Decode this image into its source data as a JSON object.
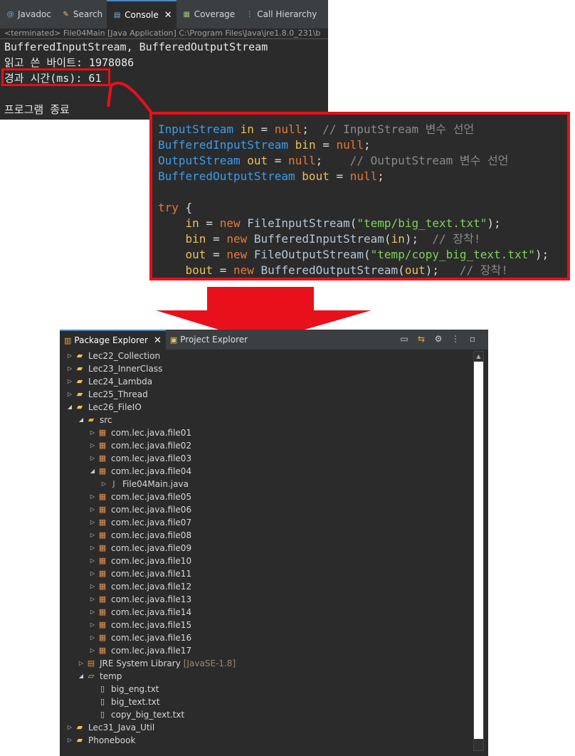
{
  "console": {
    "tabs": [
      {
        "label": "Javadoc",
        "icon": "at-icon",
        "active": false
      },
      {
        "label": "Search",
        "icon": "search-icon",
        "active": false
      },
      {
        "label": "Console",
        "icon": "console-icon",
        "active": true
      },
      {
        "label": "Coverage",
        "icon": "coverage-icon",
        "active": false
      },
      {
        "label": "Call Hierarchy",
        "icon": "hierarchy-icon",
        "active": false
      }
    ],
    "terminated_line": "<terminated> File04Main [Java Application] C:\\Program Files\\Java\\jre1.8.0_231\\b",
    "output": [
      "BufferedInputStream, BufferedOutputStream",
      "읽고 쓴 바이트: 1978086",
      "경과 시간(ms): 61",
      "",
      "프로그램 종료"
    ]
  },
  "code": {
    "lines": [
      [
        [
          "t-type",
          "InputStream"
        ],
        [
          "t-op",
          " "
        ],
        [
          "t-var",
          "in"
        ],
        [
          "t-op",
          " = "
        ],
        [
          "t-kw",
          "null"
        ],
        [
          "t-op",
          ";  "
        ],
        [
          "t-com",
          "// InputStream 변수 선언"
        ]
      ],
      [
        [
          "t-type",
          "BufferedInputStream"
        ],
        [
          "t-op",
          " "
        ],
        [
          "t-var",
          "bin"
        ],
        [
          "t-op",
          " = "
        ],
        [
          "t-kw",
          "null"
        ],
        [
          "t-op",
          ";"
        ]
      ],
      [
        [
          "t-type",
          "OutputStream"
        ],
        [
          "t-op",
          " "
        ],
        [
          "t-var",
          "out"
        ],
        [
          "t-op",
          " = "
        ],
        [
          "t-kw",
          "null"
        ],
        [
          "t-op",
          ";    "
        ],
        [
          "t-com",
          "// OutputStream 변수 선언"
        ]
      ],
      [
        [
          "t-type",
          "BufferedOutputStream"
        ],
        [
          "t-op",
          " "
        ],
        [
          "t-var",
          "bout"
        ],
        [
          "t-op",
          " = "
        ],
        [
          "t-kw",
          "null"
        ],
        [
          "t-op",
          ";"
        ]
      ],
      [
        [
          "t-op",
          ""
        ]
      ],
      [
        [
          "t-kw",
          "try"
        ],
        [
          "t-op",
          " {"
        ]
      ],
      [
        [
          "t-op",
          "    "
        ],
        [
          "t-var",
          "in"
        ],
        [
          "t-op",
          " = "
        ],
        [
          "t-kw",
          "new"
        ],
        [
          "t-op",
          " "
        ],
        [
          "t-fn",
          "FileInputStream"
        ],
        [
          "t-op",
          "("
        ],
        [
          "t-str",
          "\"temp/big_text.txt\""
        ],
        [
          "t-op",
          ");"
        ]
      ],
      [
        [
          "t-op",
          "    "
        ],
        [
          "t-var",
          "bin"
        ],
        [
          "t-op",
          " = "
        ],
        [
          "t-kw",
          "new"
        ],
        [
          "t-op",
          " "
        ],
        [
          "t-fn",
          "BufferedInputStream"
        ],
        [
          "t-op",
          "("
        ],
        [
          "t-var",
          "in"
        ],
        [
          "t-op",
          ");  "
        ],
        [
          "t-com",
          "// 장착!"
        ]
      ],
      [
        [
          "t-op",
          "    "
        ],
        [
          "t-var",
          "out"
        ],
        [
          "t-op",
          " = "
        ],
        [
          "t-kw",
          "new"
        ],
        [
          "t-op",
          " "
        ],
        [
          "t-fn",
          "FileOutputStream"
        ],
        [
          "t-op",
          "("
        ],
        [
          "t-str",
          "\"temp/copy_big_text.txt\""
        ],
        [
          "t-op",
          ");"
        ]
      ],
      [
        [
          "t-op",
          "    "
        ],
        [
          "t-var",
          "bout"
        ],
        [
          "t-op",
          " = "
        ],
        [
          "t-kw",
          "new"
        ],
        [
          "t-op",
          " "
        ],
        [
          "t-fn",
          "BufferedOutputStream"
        ],
        [
          "t-op",
          "("
        ],
        [
          "t-var",
          "out"
        ],
        [
          "t-op",
          ");   "
        ],
        [
          "t-com",
          "// 장착!"
        ]
      ]
    ]
  },
  "explorer": {
    "tabs": [
      {
        "label": "Package Explorer",
        "active": true
      },
      {
        "label": "Project Explorer",
        "active": false
      }
    ],
    "tree": [
      {
        "depth": 0,
        "tw": "right",
        "icon": "project",
        "label": "Lec22_Collection"
      },
      {
        "depth": 0,
        "tw": "right",
        "icon": "project",
        "label": "Lec23_InnerClass"
      },
      {
        "depth": 0,
        "tw": "right",
        "icon": "project",
        "label": "Lec24_Lambda"
      },
      {
        "depth": 0,
        "tw": "right",
        "icon": "project",
        "label": "Lec25_Thread"
      },
      {
        "depth": 0,
        "tw": "down",
        "icon": "project",
        "label": "Lec26_FileIO"
      },
      {
        "depth": 1,
        "tw": "down",
        "icon": "src",
        "label": "src"
      },
      {
        "depth": 2,
        "tw": "right",
        "icon": "pkg",
        "label": "com.lec.java.file01"
      },
      {
        "depth": 2,
        "tw": "right",
        "icon": "pkg",
        "label": "com.lec.java.file02"
      },
      {
        "depth": 2,
        "tw": "right",
        "icon": "pkg",
        "label": "com.lec.java.file03"
      },
      {
        "depth": 2,
        "tw": "down",
        "icon": "pkg",
        "label": "com.lec.java.file04"
      },
      {
        "depth": 3,
        "tw": "right",
        "icon": "java",
        "label": "File04Main.java"
      },
      {
        "depth": 2,
        "tw": "right",
        "icon": "pkg",
        "label": "com.lec.java.file05"
      },
      {
        "depth": 2,
        "tw": "right",
        "icon": "pkg",
        "label": "com.lec.java.file06"
      },
      {
        "depth": 2,
        "tw": "right",
        "icon": "pkg",
        "label": "com.lec.java.file07"
      },
      {
        "depth": 2,
        "tw": "right",
        "icon": "pkg",
        "label": "com.lec.java.file08"
      },
      {
        "depth": 2,
        "tw": "right",
        "icon": "pkg",
        "label": "com.lec.java.file09"
      },
      {
        "depth": 2,
        "tw": "right",
        "icon": "pkg",
        "label": "com.lec.java.file10"
      },
      {
        "depth": 2,
        "tw": "right",
        "icon": "pkg",
        "label": "com.lec.java.file11"
      },
      {
        "depth": 2,
        "tw": "right",
        "icon": "pkg",
        "label": "com.lec.java.file12"
      },
      {
        "depth": 2,
        "tw": "right",
        "icon": "pkg",
        "label": "com.lec.java.file13"
      },
      {
        "depth": 2,
        "tw": "right",
        "icon": "pkg",
        "label": "com.lec.java.file14"
      },
      {
        "depth": 2,
        "tw": "right",
        "icon": "pkg",
        "label": "com.lec.java.file15"
      },
      {
        "depth": 2,
        "tw": "right",
        "icon": "pkg",
        "label": "com.lec.java.file16"
      },
      {
        "depth": 2,
        "tw": "right",
        "icon": "pkg",
        "label": "com.lec.java.file17"
      },
      {
        "depth": 1,
        "tw": "right",
        "icon": "lib",
        "label": "JRE System Library",
        "suffix": "[JavaSE-1.8]"
      },
      {
        "depth": 1,
        "tw": "down",
        "icon": "folder",
        "label": "temp"
      },
      {
        "depth": 2,
        "tw": "none",
        "icon": "file",
        "label": "big_eng.txt"
      },
      {
        "depth": 2,
        "tw": "none",
        "icon": "file",
        "label": "big_text.txt"
      },
      {
        "depth": 2,
        "tw": "none",
        "icon": "file",
        "label": "copy_big_text.txt"
      },
      {
        "depth": 0,
        "tw": "right",
        "icon": "project",
        "label": "Lec31_Java_Util"
      },
      {
        "depth": 0,
        "tw": "right",
        "icon": "project",
        "label": "Phonebook"
      }
    ]
  },
  "colors": {
    "highlight": "#e8101a",
    "panel_bg": "#2b2b2b",
    "tab_bar": "#3c3f41"
  }
}
